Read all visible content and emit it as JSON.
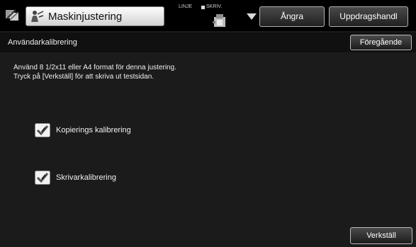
{
  "header": {
    "title": "Maskinjustering",
    "status_line": "LINJE",
    "status_print": "SKRIV.",
    "undo_label": "Ångra",
    "jobs_label": "Uppdragshandl"
  },
  "subheader": {
    "title": "Användarkalibrering",
    "back_label": "Föregående"
  },
  "instructions": [
    "Använd 8 1/2x11 eller A4 format för denna justering.",
    "Tryck på [Verkställ] för att skriva ut testsidan."
  ],
  "options": [
    {
      "label": "Kopierings kalibrering",
      "icon": "checkbox-checked-icon"
    },
    {
      "label": "Skrivarkalibrering",
      "icon": "checkbox-checked-icon"
    }
  ],
  "footer": {
    "execute_label": "Verkställ"
  },
  "colors": {
    "background": "#1b1b1b",
    "title_box": "#e8e8e8",
    "button_border": "#b0b0b0"
  }
}
